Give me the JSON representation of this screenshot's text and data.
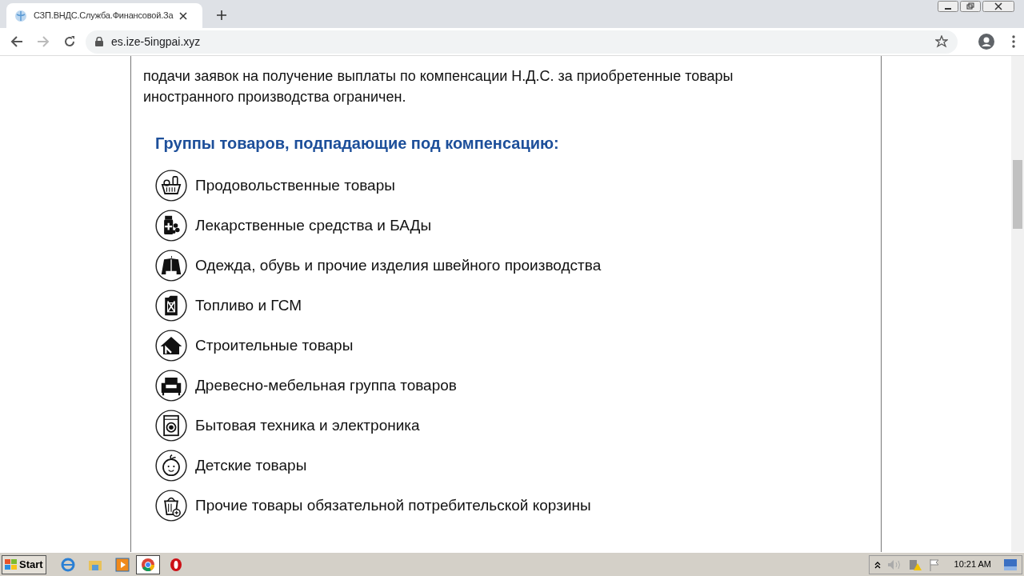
{
  "browser": {
    "tab_title": "СЗП.ВНДС.Служба.Финансовой.За",
    "url": "es.ize-5ingpai.xyz"
  },
  "page": {
    "paragraph_lines": [
      "подачи заявок на получение выплаты по компенсации Н.Д.С. за приобретенные товары",
      "иностранного производства ограничен."
    ],
    "heading": "Группы товаров, подпадающие под компенсацию:",
    "groups": [
      {
        "label": "Продовольственные товары"
      },
      {
        "label": "Лекарственные средства и БАДы"
      },
      {
        "label": "Одежда, обувь и прочие изделия швейного производства"
      },
      {
        "label": "Топливо и ГСМ"
      },
      {
        "label": "Строительные товары"
      },
      {
        "label": "Древесно-мебельная группа товаров"
      },
      {
        "label": "Бытовая техника и электроника"
      },
      {
        "label": "Детские товары"
      },
      {
        "label": "Прочие товары обязательной потребительской корзины"
      }
    ]
  },
  "taskbar": {
    "start": "Start",
    "clock": "10:21 AM"
  }
}
